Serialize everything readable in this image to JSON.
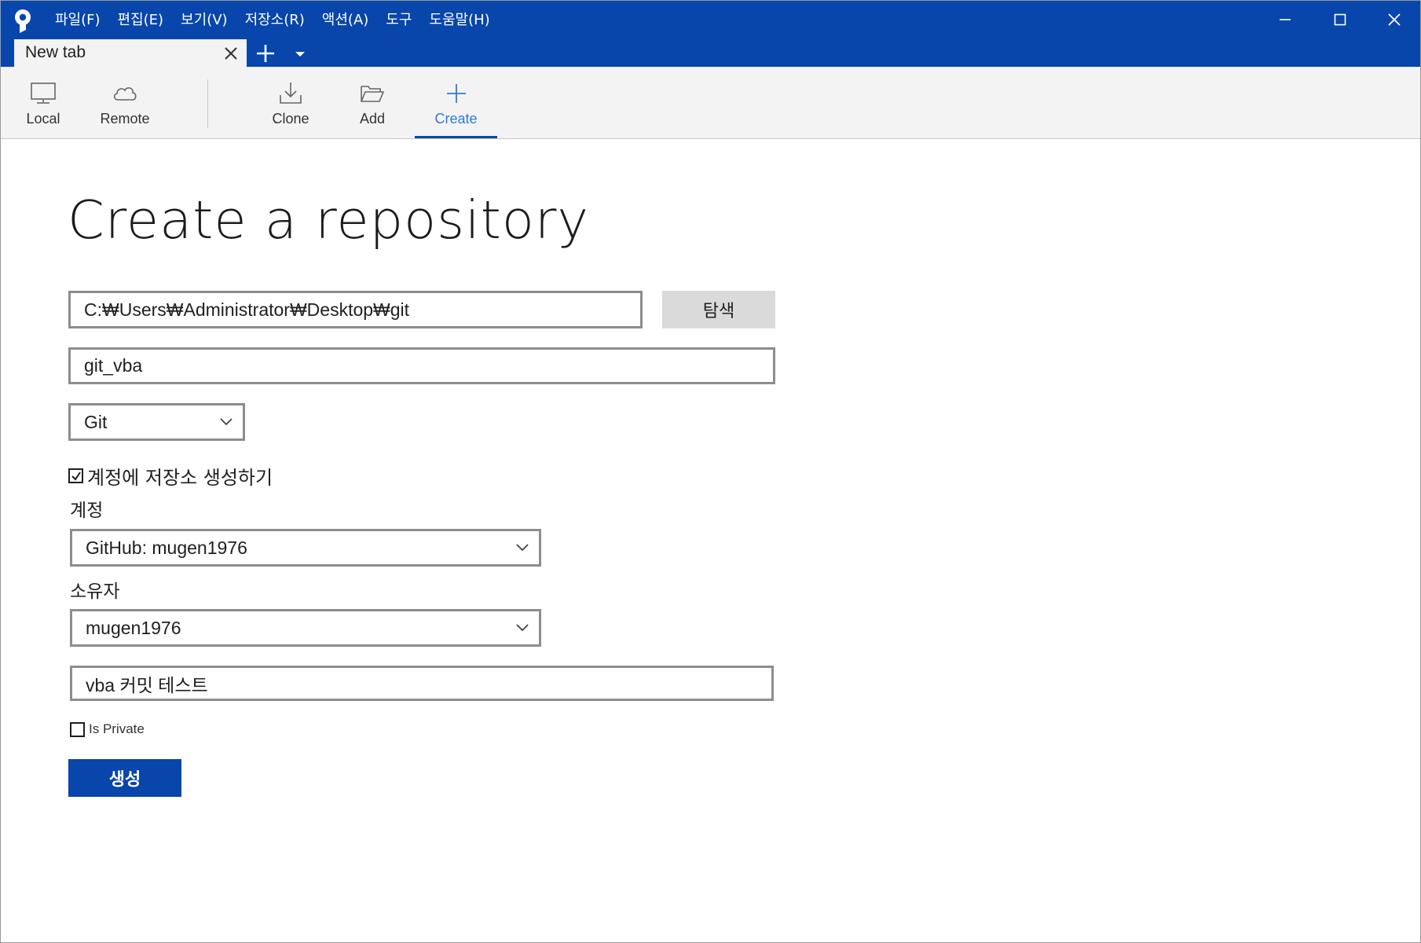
{
  "window": {
    "menu": [
      "파일(F)",
      "편집(E)",
      "보기(V)",
      "저장소(R)",
      "액션(A)",
      "도구",
      "도움말(H)"
    ],
    "tab_label": "New tab"
  },
  "toolbar": {
    "local": "Local",
    "remote": "Remote",
    "clone": "Clone",
    "add": "Add",
    "create": "Create",
    "active": "create"
  },
  "form": {
    "title": "Create a repository",
    "path_value": "C:₩Users₩Administrator₩Desktop₩git",
    "browse_label": "탐색",
    "name_value": "git_vba",
    "vcs_selected": "Git",
    "create_remote_label": "계정에 저장소 생성하기",
    "create_remote_checked": true,
    "account_label": "계정",
    "account_selected": "GitHub: mugen1976",
    "owner_label": "소유자",
    "owner_selected": "mugen1976",
    "description_value": "vba 커밋 테스트",
    "is_private_label": "Is Private",
    "is_private_checked": false,
    "submit_label": "생성"
  },
  "colors": {
    "titlebar": "#0846ab",
    "accent": "#2c7bd6",
    "toolbar_bg": "#f3f3f3"
  },
  "icons": {
    "app": "sourcetree-logo-icon",
    "local": "monitor-icon",
    "remote": "cloud-icon",
    "clone": "download-icon",
    "add": "folder-open-icon",
    "create": "plus-icon"
  }
}
